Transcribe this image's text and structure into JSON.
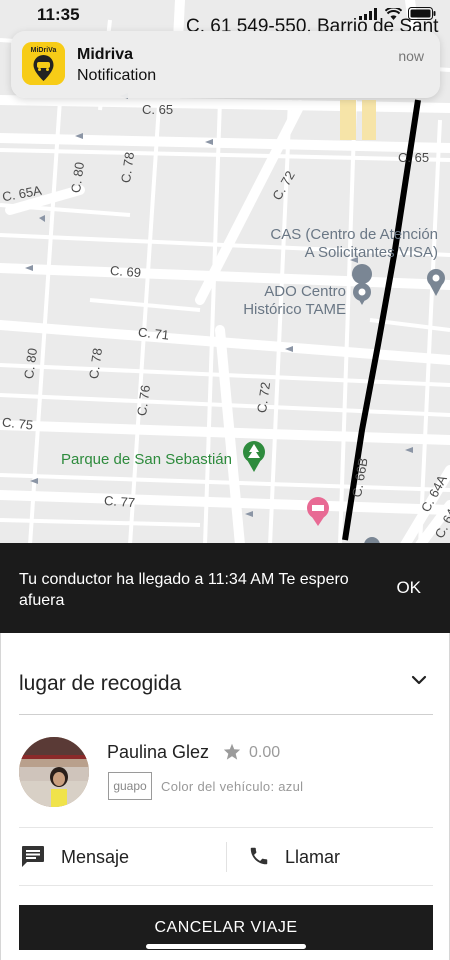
{
  "status_bar": {
    "time": "11:35",
    "street_overlay": "C. 61 549-550, Barrio de Sant"
  },
  "notification": {
    "app_name": "Midriva",
    "icon_text": "MiDriVa",
    "body": "Notification",
    "time": "now"
  },
  "map": {
    "street_labels": [
      "C. 65",
      "C. 65",
      "C. 65A",
      "C. 80",
      "C. 78",
      "C. 72",
      "C. 69",
      "C. 71",
      "C. 80",
      "C. 78",
      "C. 76",
      "C. 72",
      "C. 75",
      "C. 77",
      "C. 66B",
      "C. 64A",
      "C. 64"
    ],
    "pois": {
      "cas": "CAS (Centro de Atención A Solicitantes VISA)",
      "ado": "ADO Centro Histórico TAME",
      "park": "Parque de San Sebastián"
    },
    "route_color": "#000000",
    "park_color": "#2e8b3d",
    "hotel_color": "#e86a94"
  },
  "snackbar": {
    "message": "Tu conductor ha llegado a  11:34 AM Te espero afuera",
    "action": "OK"
  },
  "sheet": {
    "pickup_label": "lugar de recogida",
    "driver": {
      "name": "Paulina Glez",
      "rating": "0.00",
      "plate": "guapo",
      "vehicle_color": "Color del vehículo: azul"
    },
    "actions": {
      "message": "Mensaje",
      "call": "Llamar"
    },
    "cancel": "CANCELAR VIAJE"
  }
}
